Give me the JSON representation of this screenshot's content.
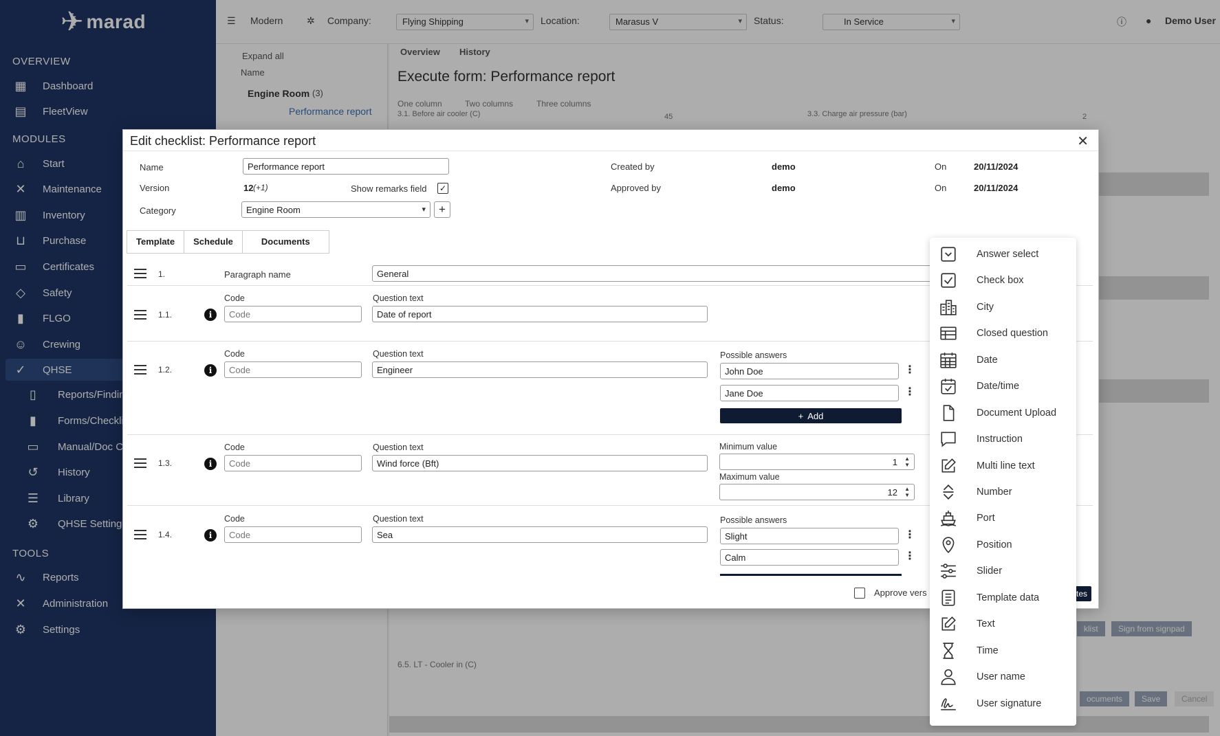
{
  "app": {
    "logo_text": "marad",
    "sidebar": {
      "overview_title": "OVERVIEW",
      "modules_title": "MODULES",
      "tools_title": "TOOLS",
      "overview_items": [
        "Dashboard",
        "FleetView"
      ],
      "module_items": [
        "Start",
        "Maintenance",
        "Inventory",
        "Purchase",
        "Certificates",
        "Safety",
        "FLGO",
        "Crewing",
        "QHSE"
      ],
      "qhse_sub": [
        "Reports/Findin",
        "Forms/Checkli",
        "Manual/Doc C",
        "History",
        "Library",
        "QHSE Setting"
      ],
      "tool_items": [
        "Reports",
        "Administration",
        "Settings"
      ]
    },
    "topbar": {
      "theme": "Modern",
      "company_label": "Company:",
      "company_value": "Flying Shipping",
      "location_label": "Location:",
      "location_value": "Marasus V",
      "status_label": "Status:",
      "status_value": "In Service",
      "user": "Demo User"
    },
    "tree": {
      "expand_all": "Expand all",
      "name_header": "Name",
      "group": "Engine Room",
      "group_count": "(3)",
      "item": "Performance report"
    },
    "main": {
      "tabs": [
        "Overview",
        "History"
      ],
      "title": "Execute form: Performance report",
      "column_tabs": [
        "One column",
        "Two columns",
        "Three columns"
      ],
      "field_a": "3.1. Before air cooler (C)",
      "field_a_value": "45",
      "field_b": "3.3. Charge air pressure (bar)",
      "field_b_value": "2",
      "field_c": "6.5. LT - Cooler in (C)",
      "btn_checklist": "klist",
      "btn_signpad": "Sign from signpad",
      "btn_documents": "ocuments",
      "btn_save": "Save",
      "btn_cancel": "Cancel"
    }
  },
  "modal": {
    "title": "Edit checklist: Performance report",
    "name_label": "Name",
    "name_value": "Performance report",
    "version_label": "Version",
    "version_value": "12",
    "version_delta": "(+1)",
    "show_remarks_label": "Show remarks field",
    "category_label": "Category",
    "category_value": "Engine Room",
    "created_by_label": "Created by",
    "created_by_value": "demo",
    "approved_by_label": "Approved by",
    "approved_by_value": "demo",
    "on_label": "On",
    "created_on": "20/11/2024",
    "approved_on": "20/11/2024",
    "tabs": [
      "Template",
      "Schedule",
      "Documents"
    ],
    "paragraph": {
      "num": "1.",
      "label": "Paragraph name",
      "value": "General"
    },
    "code_label": "Code",
    "code_placeholder": "Code",
    "question_label": "Question text",
    "possible_answers_label": "Possible answers",
    "min_label": "Minimum value",
    "max_label": "Maximum value",
    "add_label": "Add",
    "questions": [
      {
        "num": "1.1.",
        "text": "Date of report"
      },
      {
        "num": "1.2.",
        "text": "Engineer",
        "answers": [
          "John Doe",
          "Jane Doe"
        ]
      },
      {
        "num": "1.3.",
        "text": "Wind force (Bft)",
        "min": "1",
        "max": "12"
      },
      {
        "num": "1.4.",
        "text": "Sea",
        "answers": [
          "Slight",
          "Calm"
        ]
      }
    ],
    "approve_label": "Approve vers",
    "footer_btn": "tes"
  },
  "dropdown": {
    "items": [
      {
        "label": "Answer select",
        "icon": "answer-select-icon"
      },
      {
        "label": "Check box",
        "icon": "check-box-icon"
      },
      {
        "label": "City",
        "icon": "city-icon"
      },
      {
        "label": "Closed question",
        "icon": "table-icon"
      },
      {
        "label": "Date",
        "icon": "calendar-icon"
      },
      {
        "label": "Date/time",
        "icon": "calendar-check-icon"
      },
      {
        "label": "Document Upload",
        "icon": "document-icon"
      },
      {
        "label": "Instruction",
        "icon": "speech-bubble-icon"
      },
      {
        "label": "Multi line text",
        "icon": "edit-icon"
      },
      {
        "label": "Number",
        "icon": "up-down-icon"
      },
      {
        "label": "Port",
        "icon": "ship-icon"
      },
      {
        "label": "Position",
        "icon": "map-pin-icon"
      },
      {
        "label": "Slider",
        "icon": "slider-icon"
      },
      {
        "label": "Template data",
        "icon": "template-icon"
      },
      {
        "label": "Text",
        "icon": "pencil-icon"
      },
      {
        "label": "Time",
        "icon": "hourglass-icon"
      },
      {
        "label": "User name",
        "icon": "user-icon"
      },
      {
        "label": "User signature",
        "icon": "signature-icon"
      }
    ]
  }
}
